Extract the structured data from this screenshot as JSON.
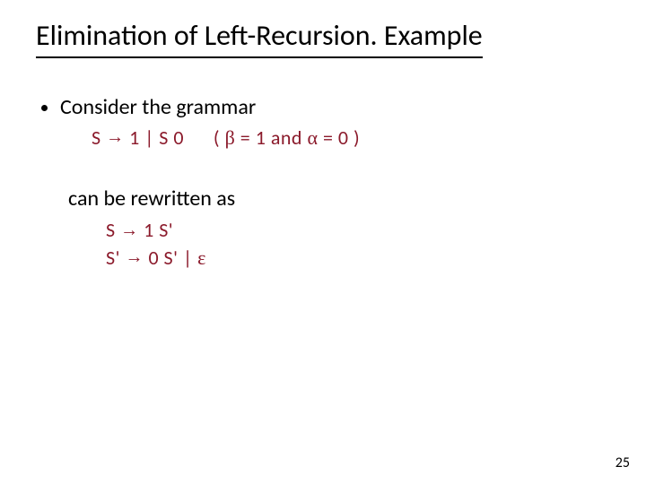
{
  "title": "Elimination of Left-Recursion. Example",
  "bullet": "Consider the grammar",
  "grammar": {
    "lhs": "S",
    "arrow": "→",
    "rhs": "1 | S 0",
    "cond_open": "(",
    "beta": "β",
    "eq1": " = 1 and ",
    "alpha": "α",
    "eq2": " = 0 ",
    "cond_close": ")"
  },
  "rewrite_intro": "can be rewritten as",
  "rewrite": {
    "r1_lhs": "S",
    "r1_arrow": "→",
    "r1_rhs": "1 S'",
    "r2_lhs": "S'",
    "r2_arrow": "→",
    "r2_rhs_a": "0 S' | ",
    "eps": "ε"
  },
  "page_number": "25"
}
